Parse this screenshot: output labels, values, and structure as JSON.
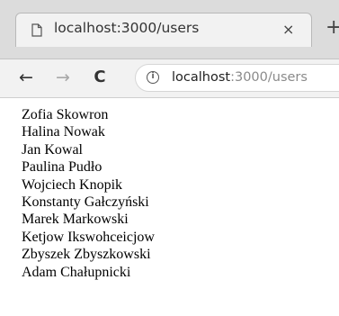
{
  "tab": {
    "title": "localhost:3000/users",
    "close_glyph": "×",
    "page_icon": "page-icon"
  },
  "toolbar": {
    "back_glyph": "←",
    "forward_glyph": "→",
    "reload_glyph": "C",
    "newtab_glyph": "+",
    "info_glyph": "i",
    "url_host": "localhost",
    "url_path": ":3000/users"
  },
  "users": [
    "Zofia Skowron",
    "Halina Nowak",
    "Jan Kowal",
    "Paulina Pudło",
    "Wojciech Knopik",
    "Konstanty Gałczyński",
    "Marek Markowski",
    "Ketjow Ikswohceicjow",
    "Zbyszek Zbyszkowski",
    "Adam Chałupnicki"
  ]
}
